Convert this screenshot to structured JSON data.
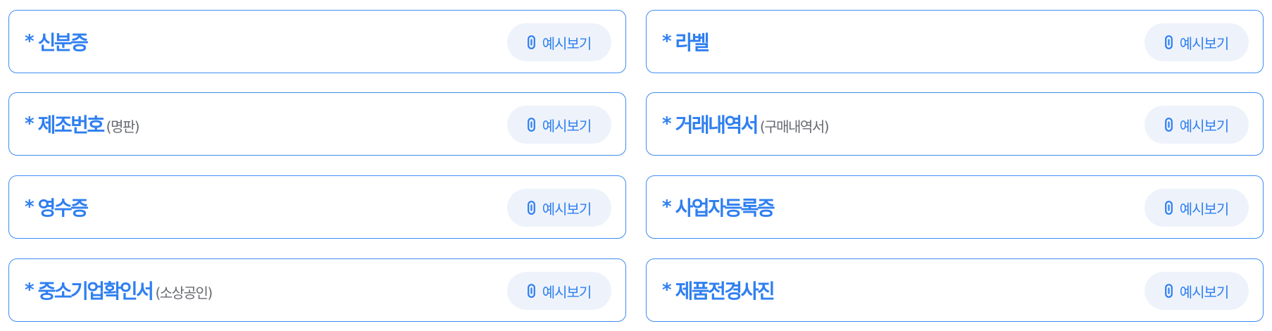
{
  "required_marker": "*",
  "example_button": {
    "label": "예시보기",
    "icon": "link-icon"
  },
  "colors": {
    "accent": "#2f7ff0",
    "border": "#3f8cf0",
    "button_bg": "#eef3fb",
    "sub_text": "#666a70"
  },
  "documents": [
    {
      "title": "신분증",
      "sub": ""
    },
    {
      "title": "라벨",
      "sub": ""
    },
    {
      "title": "제조번호",
      "sub": "(명판)"
    },
    {
      "title": "거래내역서",
      "sub": "(구매내역서)"
    },
    {
      "title": "영수증",
      "sub": ""
    },
    {
      "title": "사업자등록증",
      "sub": ""
    },
    {
      "title": "중소기업확인서",
      "sub": "(소상공인)"
    },
    {
      "title": "제품전경사진",
      "sub": ""
    }
  ]
}
